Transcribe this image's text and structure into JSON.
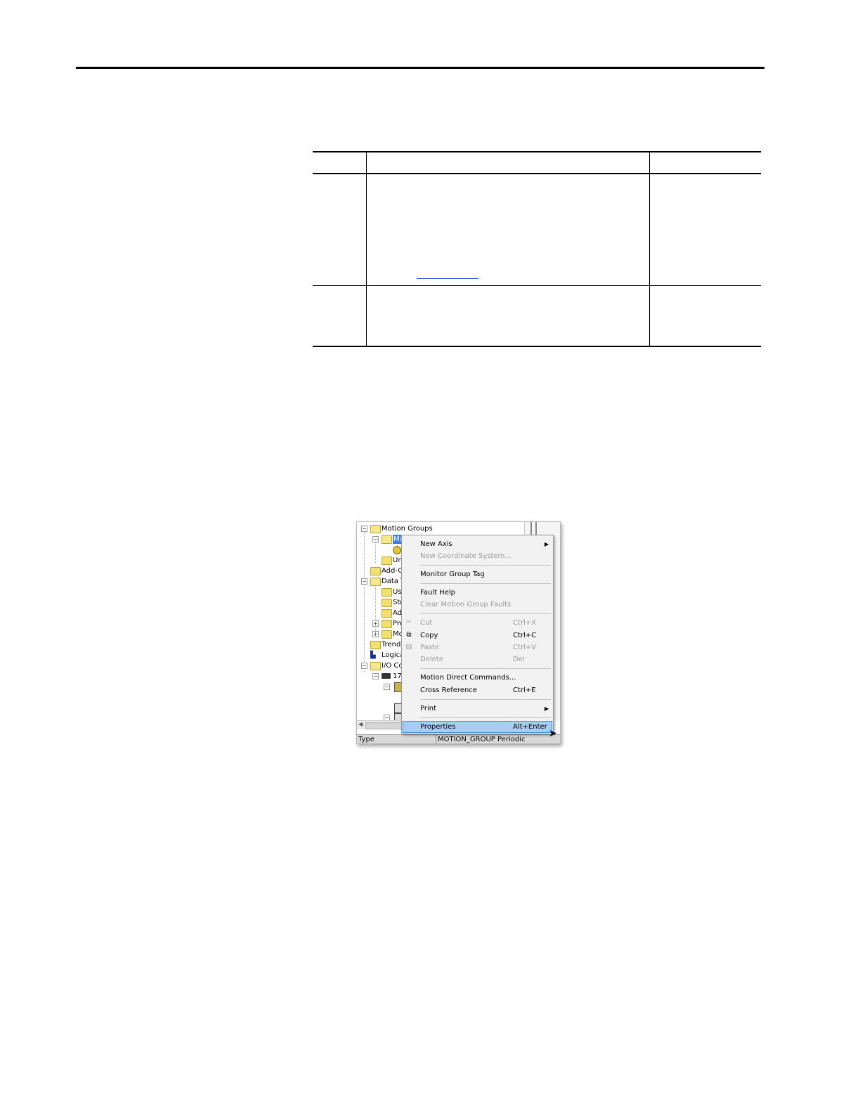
{
  "screenshot": {
    "tree": {
      "motion_groups": "Motion Groups",
      "selected": "Mo",
      "unassigned": "Un",
      "add_on": "Add-O",
      "data_types": "Data T",
      "user_defined": "Us",
      "strings": "Str",
      "add_on_defined": "Ad",
      "predefined": "Pre",
      "module_defined": "Mo",
      "trends": "Trends",
      "logical_model": "Logica",
      "io_config": "I/O Co",
      "backplane": "175"
    },
    "menu": {
      "items": [
        {
          "label": "New Axis",
          "shortcut": "",
          "disabled": false,
          "submenu": true
        },
        {
          "label": "New Coordinate System...",
          "shortcut": "",
          "disabled": true,
          "submenu": false
        },
        {
          "label": "Monitor Group Tag",
          "shortcut": "",
          "disabled": false,
          "submenu": false
        },
        {
          "label": "Fault Help",
          "shortcut": "",
          "disabled": false,
          "submenu": false
        },
        {
          "label": "Clear Motion Group Faults",
          "shortcut": "",
          "disabled": true,
          "submenu": false
        },
        {
          "label": "Cut",
          "shortcut": "Ctrl+X",
          "disabled": true,
          "submenu": false
        },
        {
          "label": "Copy",
          "shortcut": "Ctrl+C",
          "disabled": false,
          "submenu": false
        },
        {
          "label": "Paste",
          "shortcut": "Ctrl+V",
          "disabled": true,
          "submenu": false
        },
        {
          "label": "Delete",
          "shortcut": "Del",
          "disabled": true,
          "submenu": false
        },
        {
          "label": "Motion Direct Commands...",
          "shortcut": "",
          "disabled": false,
          "submenu": false
        },
        {
          "label": "Cross Reference",
          "shortcut": "Ctrl+E",
          "disabled": false,
          "submenu": false
        },
        {
          "label": "Print",
          "shortcut": "",
          "disabled": false,
          "submenu": true
        },
        {
          "label": "Properties",
          "shortcut": "Alt+Enter",
          "disabled": false,
          "submenu": false
        }
      ],
      "submenu_arrow": "▶",
      "highlight_color": "#a7cdf5"
    },
    "status": {
      "type_label": "Type",
      "type_value": "MOTION_GROUP Periodic"
    }
  }
}
